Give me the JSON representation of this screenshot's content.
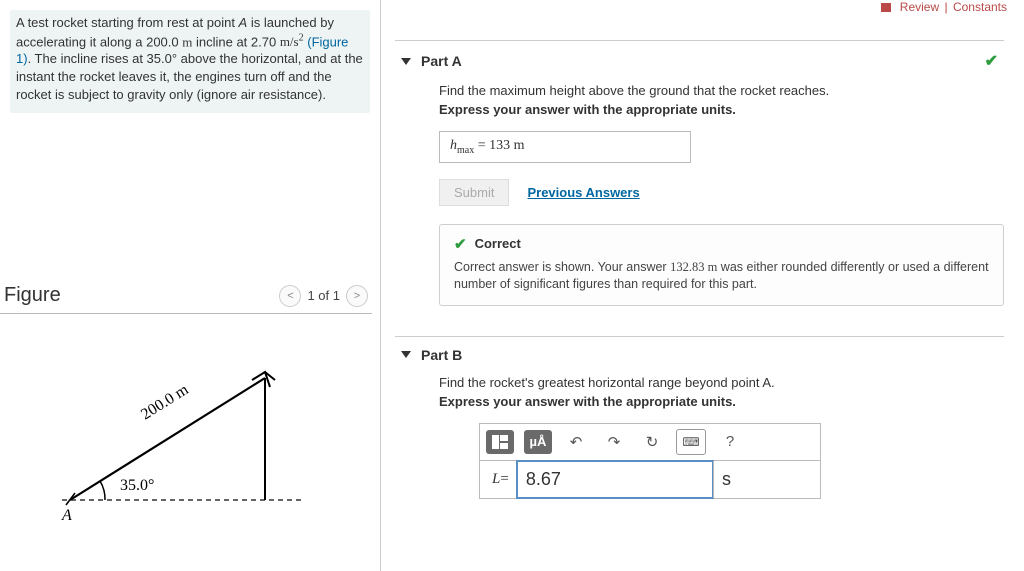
{
  "top_links": {
    "review": "Review",
    "constants": "Constants"
  },
  "problem": {
    "text_a": "A test rocket starting from rest at point ",
    "point": "A",
    "text_b": " is launched by accelerating it along a 200.0 ",
    "unit_len": "m",
    "text_c": " incline at 2.70 ",
    "accel_val": "m/s",
    "text_d": " ",
    "fig_ref": "(Figure 1)",
    "text_e": ". The incline rises at 35.0° above the horizontal, and at the instant the rocket leaves it, the engines turn off and the rocket is subject to gravity only (ignore air resistance).",
    "accel_exp": "2"
  },
  "figure": {
    "title": "Figure",
    "nav": {
      "prev": "<",
      "count": "1 of 1",
      "next": ">"
    },
    "len_label": "200.0 m",
    "angle_label": "35.0°",
    "point_label": "A"
  },
  "partA": {
    "title": "Part A",
    "prompt": "Find the maximum height above the ground that the rocket reaches.",
    "instruct": "Express your answer with the appropriate units.",
    "var": "h",
    "var_sub": "max",
    "eq": "  =  ",
    "answer": "133 m",
    "submit": "Submit",
    "prev": "Previous Answers",
    "fb_title": "Correct",
    "fb_text_a": "Correct answer is shown. Your answer ",
    "fb_val": "132.83 m",
    "fb_text_b": " was either rounded differently or used a different number of significant figures than required for this part."
  },
  "partB": {
    "title": "Part B",
    "prompt": "Find the rocket's greatest horizontal range beyond point A.",
    "instruct": "Express your answer with the appropriate units.",
    "tb": {
      "tmpl": "□",
      "mu": "µÅ",
      "undo": "↶",
      "redo": "↷",
      "reset": "↻",
      "kb": "⌨",
      "help": "?"
    },
    "var": "L",
    "eq": " = ",
    "value": "8.67",
    "unit": "s"
  }
}
